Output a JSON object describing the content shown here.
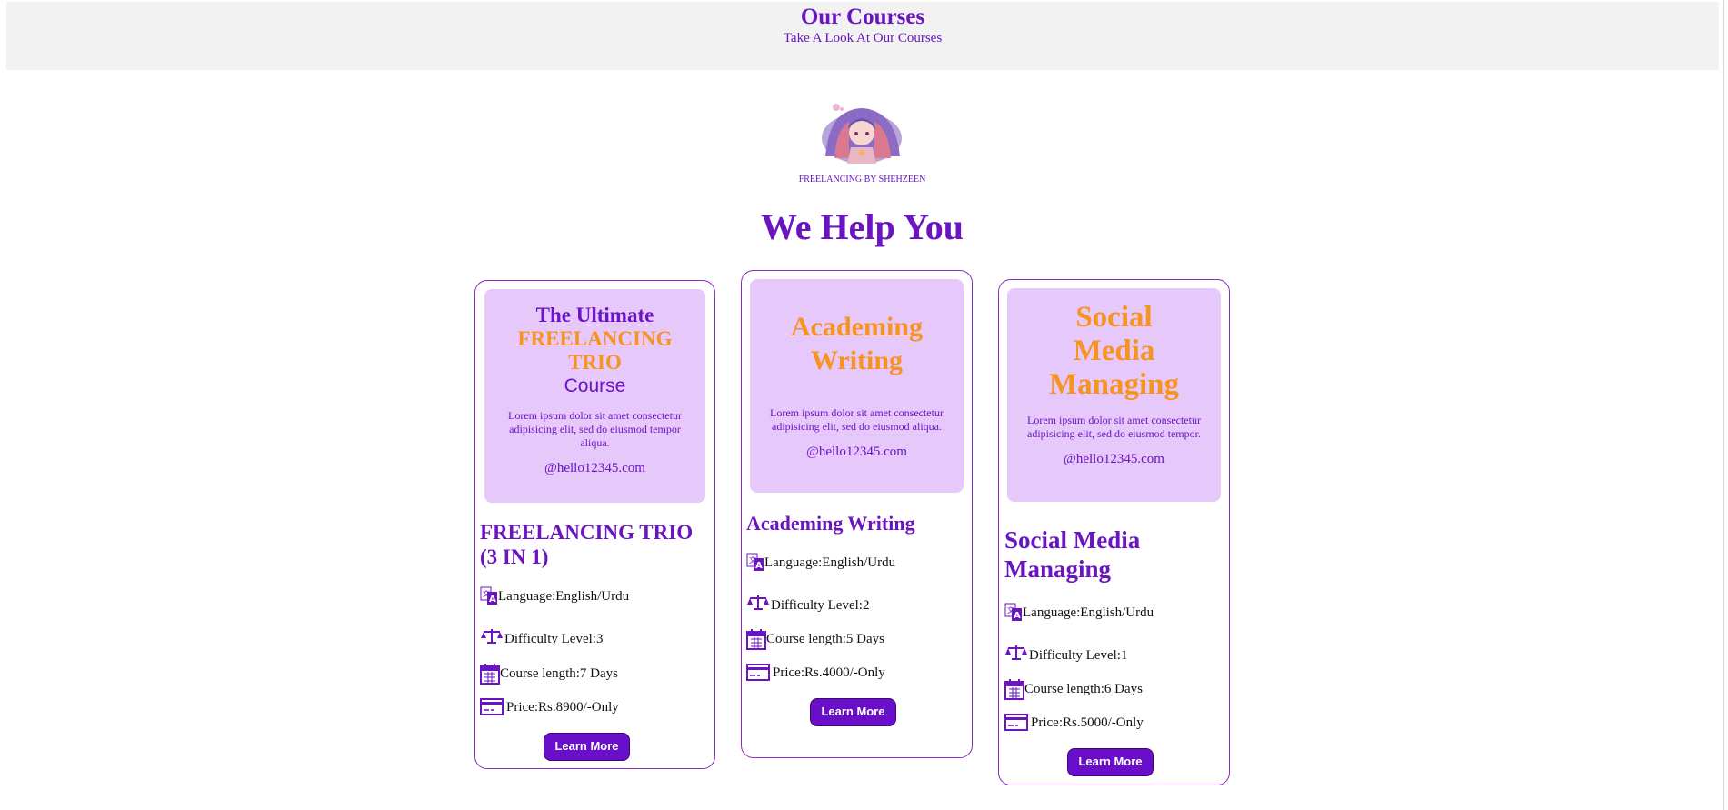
{
  "header": {
    "title": "Our Courses",
    "subtitle": "Take A Look At Our Courses"
  },
  "brand": {
    "caption": "FREELANCING BY SHEHZEEN"
  },
  "headline": "We Help You",
  "cards": [
    {
      "banner_line1": "The Ultimate",
      "banner_line2": "FREELANCING TRIO",
      "banner_line3": "Course",
      "lorem": "Lorem ipsum dolor sit amet consectetur adipisicing elit, sed do eiusmod tempor aliqua.",
      "handle": "@hello12345.com",
      "title": "FREELANCING TRIO (3 IN 1)",
      "language": "Language:English/Urdu",
      "difficulty": "Difficulty Level:3",
      "length": "Course length:7 Days",
      "price": "Price:Rs.8900/-Only",
      "button": "Learn More"
    },
    {
      "banner_title": "Academing Writing",
      "lorem": "Lorem ipsum dolor sit amet consectetur adipisicing elit, sed do eiusmod aliqua.",
      "handle": "@hello12345.com",
      "title": "Academing Writing",
      "language": "Language:English/Urdu",
      "difficulty": "Difficulty Level:2",
      "length": "Course length:5 Days",
      "price": "Price:Rs.4000/-Only",
      "button": "Learn More"
    },
    {
      "banner_title": "Social Media Managing",
      "lorem": "Lorem ipsum dolor sit amet consectetur adipisicing elit, sed do eiusmod tempor.",
      "handle": "@hello12345.com",
      "title": "Social Media Managing",
      "language": "Language:English/Urdu",
      "difficulty": "Difficulty Level:1",
      "length": "Course length:6 Days",
      "price": "Price:Rs.5000/-Only",
      "button": "Learn More"
    }
  ],
  "icons": [
    "translate-icon",
    "balance-scale-icon",
    "calendar-icon",
    "credit-card-icon"
  ],
  "colors": {
    "accent": "#6a14c2",
    "orange": "#f7931e",
    "banner": "#e6c8fb",
    "button": "#6a0fc9"
  }
}
